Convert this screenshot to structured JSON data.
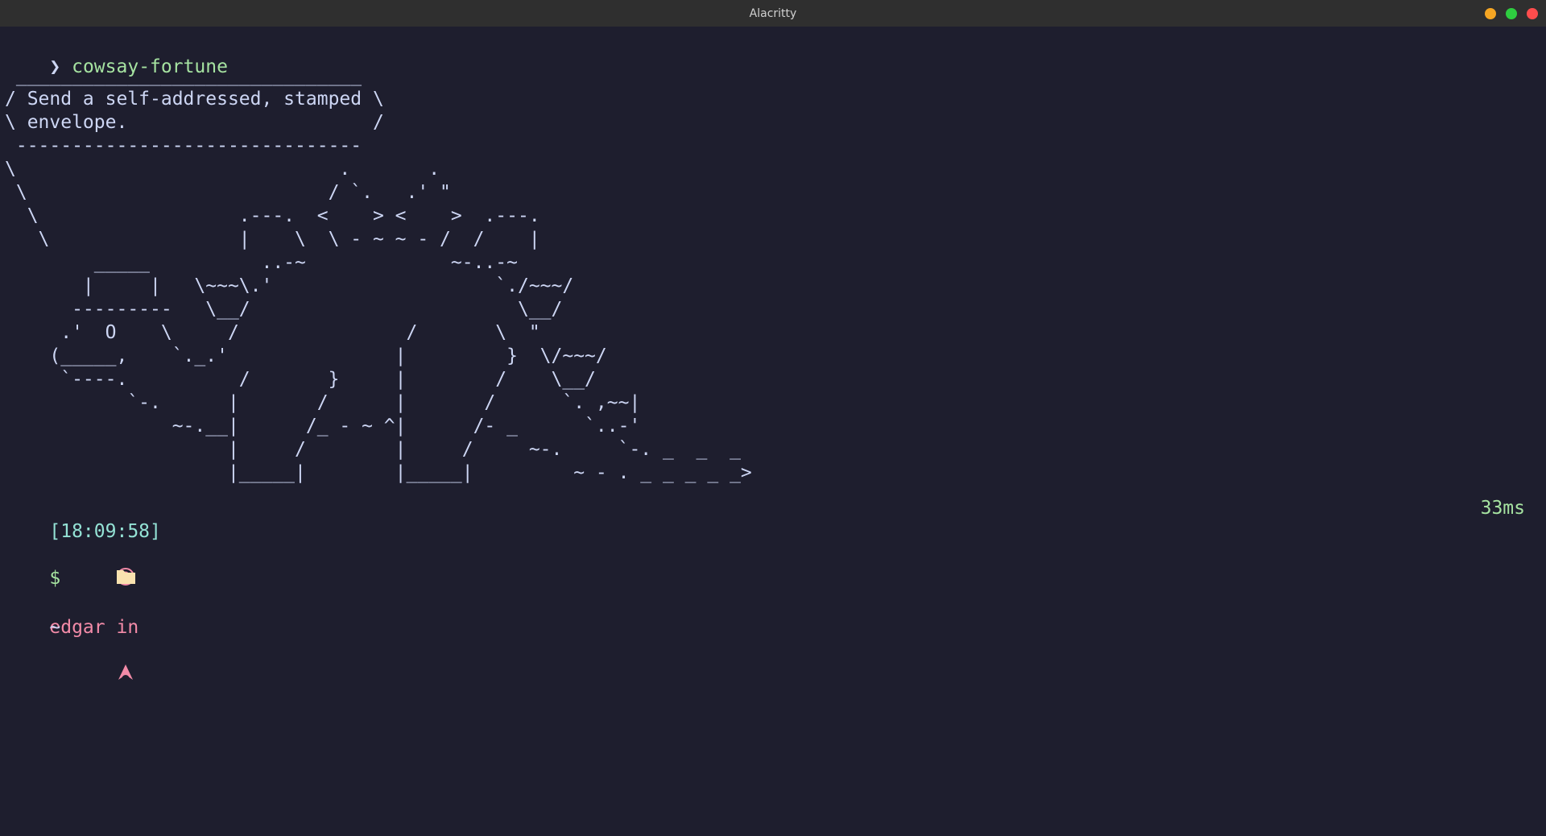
{
  "window": {
    "title": "Alacritty",
    "controls": [
      {
        "name": "minimize",
        "color": "#f5a623"
      },
      {
        "name": "maximize",
        "color": "#2ecc40"
      },
      {
        "name": "close",
        "color": "#ff4d4d"
      }
    ]
  },
  "terminal": {
    "prompt_symbol": "❯",
    "command": "cowsay-fortune",
    "ascii_art": " _______________________________\n/ Send a self-addressed, stamped \\\n\\ envelope.                      /\n -------------------------------\n\\                             .       .\n \\                           / `.   .' \"\n  \\                  .---.  <    > <    >  .---.\n   \\                 |    \\  \\ - ~ ~ - /  /    |\n        _____          ..-~             ~-..-~\n       |     |   \\~~~\\.'                    `./~~~/\n      ---------   \\__/                        \\__/\n     .'  O    \\     /               /       \\  \"\n    (_____,    `._.'               |         }  \\/~~~/\n     `----.          /       }     |        /    \\__/\n           `-.      |       /      |       /      `. ,~~|\n               ~-.__|      /_ - ~ ^|      /- _      `..-'\n                    |     /        |     /     ~-.     `-. _  _  _\n                    |_____|        |_____|         ~ - . _ _ _ _ _>",
    "status": {
      "time": "[18:09:58]",
      "user_icon": "user-circle-icon",
      "user_text": "edgar in",
      "os_icon": "arch-linux-icon",
      "duration": "33ms"
    },
    "cwd": {
      "icon": "folder-icon",
      "path": "~"
    },
    "input_prompt": "$"
  },
  "colors": {
    "background": "#1e1e2e",
    "foreground": "#cdd6f4",
    "green": "#a6e3a1",
    "teal": "#94e2d5",
    "pink": "#f38ba8",
    "folder": "#f9e2af",
    "titlebar": "#2f2f2f"
  }
}
